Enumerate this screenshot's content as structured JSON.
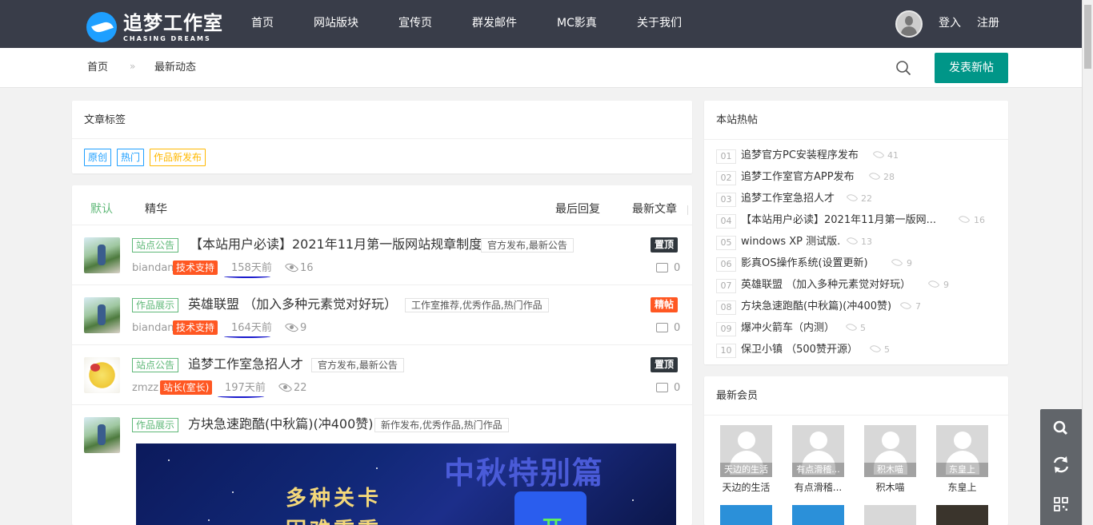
{
  "brand": {
    "title": "追梦工作室",
    "subtitle": "CHASING DREAMS"
  },
  "nav": [
    "首页",
    "网站版块",
    "宣传页",
    "群发邮件",
    "MC影真",
    "关于我们"
  ],
  "user": {
    "login": "登入",
    "register": "注册"
  },
  "breadcrumb": {
    "home": "首页",
    "sep": "»",
    "current": "最新动态"
  },
  "post_button": "发表新帖",
  "tags_panel": {
    "title": "文章标签",
    "tags": [
      "原创",
      "热门",
      "作品新发布"
    ]
  },
  "list_tabs": {
    "default": "默认",
    "featured": "精华",
    "last_reply": "最后回复",
    "latest": "最新文章"
  },
  "posts": [
    {
      "category": "站点公告",
      "title": "【本站用户必读】2021年11月第一版网站规章制度",
      "tags": "官方发布,最新公告",
      "badge": "置顶",
      "author": "biandan",
      "role": "技术支持",
      "time": "158天前",
      "views": "16",
      "comments": "0"
    },
    {
      "category": "作品展示",
      "title": "英雄联盟 （加入多种元素觉对好玩）",
      "tags": "工作室推荐,优秀作品,热门作品",
      "badge": "精帖",
      "author": "biandan",
      "role": "技术支持",
      "time": "164天前",
      "views": "9",
      "comments": "0"
    },
    {
      "category": "站点公告",
      "title": "追梦工作室急招人才",
      "tags": "官方发布,最新公告",
      "badge": "置顶",
      "author": "zmzz",
      "role": "站长(室长)",
      "time": "197天前",
      "views": "22",
      "comments": "0"
    },
    {
      "category": "作品展示",
      "title": "方块急速跑酷(中秋篇)(冲400赞)",
      "tags": "新作发布,优秀作品,热门作品",
      "cover_text": {
        "t1": "中秋特别篇",
        "t2": "多种关卡",
        "t3": "困难重重",
        "box": "开"
      }
    }
  ],
  "hot_panel": {
    "title": "本站热帖",
    "items": [
      {
        "num": "01",
        "title": "追梦官方PC安装程序发布",
        "views": "41"
      },
      {
        "num": "02",
        "title": "追梦工作室官方APP发布",
        "views": "28"
      },
      {
        "num": "03",
        "title": "追梦工作室急招人才",
        "views": "22"
      },
      {
        "num": "04",
        "title": "【本站用户必读】2021年11月第一版网...",
        "views": "16"
      },
      {
        "num": "05",
        "title": "windows XP 测试版.",
        "views": "13"
      },
      {
        "num": "06",
        "title": "影真OS操作系统(设置更新)",
        "views": "9"
      },
      {
        "num": "07",
        "title": "英雄联盟 （加入多种元素觉对好玩）",
        "views": "9"
      },
      {
        "num": "08",
        "title": "方块急速跑酷(中秋篇)(冲400赞)",
        "views": "7"
      },
      {
        "num": "09",
        "title": "爆冲火箭车（内测）",
        "views": "5"
      },
      {
        "num": "10",
        "title": "保卫小镇 （500赞开源）",
        "views": "5"
      }
    ]
  },
  "members_panel": {
    "title": "最新会员",
    "members": [
      {
        "caption": "天边的生活",
        "name": "天边的生活"
      },
      {
        "caption": "有点滑稽...",
        "name": "有点滑稽..."
      },
      {
        "caption": "积木喵",
        "name": "积木喵"
      },
      {
        "caption": "东皇上",
        "name": "东皇上"
      }
    ]
  },
  "colors": {
    "topbar": "#393d49",
    "accent": "#009688",
    "tag_blue": "#1e9fff",
    "green": "#5fb878",
    "orange": "#ff5722",
    "dark_badge": "#2f363c"
  }
}
